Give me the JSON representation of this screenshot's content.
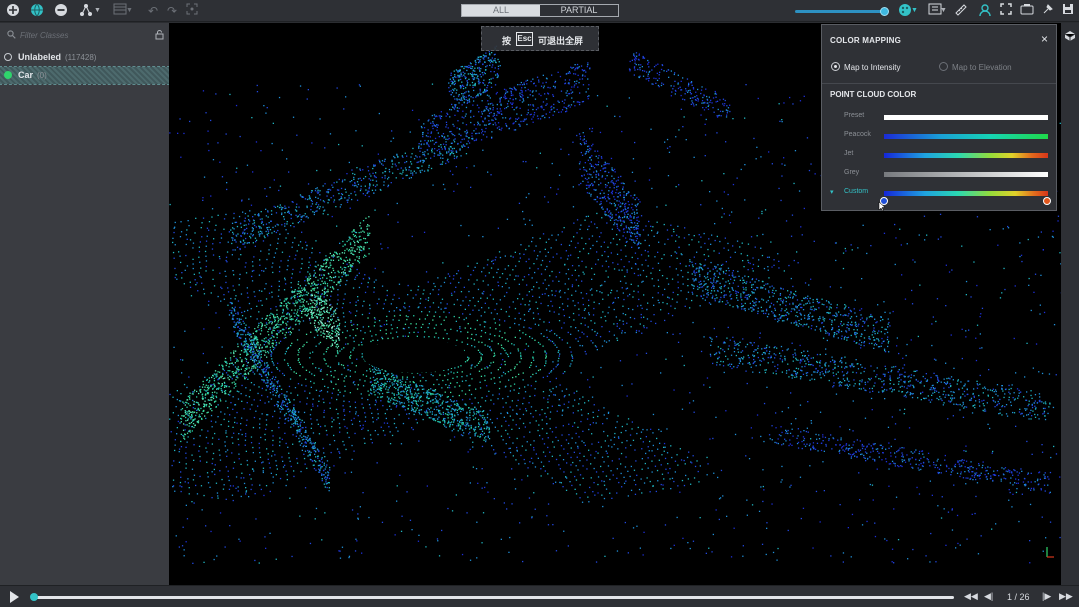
{
  "toolbar": {
    "icons": [
      "add-point-icon",
      "globe-icon",
      "minus-circle-icon",
      "graph-tool-icon",
      "layout-icon",
      "undo-icon",
      "redo-icon",
      "focus-icon",
      "color-palette-icon",
      "layers-icon",
      "ruler-icon",
      "user-icon",
      "camera-icon",
      "fullscreen-icon",
      "pin-icon",
      "save-icon"
    ],
    "mode_all": "ALL",
    "mode_partial": "PARTIAL",
    "active_mode": "ALL",
    "accent": "#33c2c7"
  },
  "sidebar": {
    "filter_placeholder": "Filter Classes",
    "classes": [
      {
        "name": "Unlabeled",
        "count": "(117428)",
        "color": "#c7cbd0",
        "selected": false
      },
      {
        "name": "Car",
        "count": "(0)",
        "color": "#2fd46c",
        "selected": true
      }
    ]
  },
  "viewport": {
    "hint_prefix": "按",
    "hint_key": "Esc",
    "hint_suffix": "可退出全屏"
  },
  "color_mapping": {
    "title": "COLOR MAPPING",
    "close": "×",
    "option_intensity": "Map to Intensity",
    "option_elevation": "Map to Elevation",
    "selected_option": "intensity",
    "section_title": "POINT CLOUD COLOR",
    "presets": [
      {
        "name": "Preset",
        "gradient": "linear-gradient(90deg,#ffffff,#ffffff)"
      },
      {
        "name": "Peacock",
        "gradient": "linear-gradient(90deg,#1b2bd6,#1aa1d6 35%,#16d4b4 65%,#1fd94a)"
      },
      {
        "name": "Jet",
        "gradient": "linear-gradient(90deg,#1526d8,#1fa3e0 25%,#2ad8b2 45%,#96dc3a 65%,#e0d22a 78%,#e26a1d 90%,#d7351a)"
      },
      {
        "name": "Grey",
        "gradient": "linear-gradient(90deg,#777a7e,#ffffff)"
      },
      {
        "name": "Custom",
        "gradient": "linear-gradient(90deg,#1526d8,#1fa3e0 25%,#2ad8b2 45%,#96dc3a 65%,#e0d22a 80%,#e26a1d 92%,#d7351a)",
        "expanded": true
      }
    ],
    "handle_low_color": "#2150d8",
    "handle_high_color": "#e2571d"
  },
  "playback": {
    "progress": 0.0,
    "frame_label": "1 / 26"
  }
}
